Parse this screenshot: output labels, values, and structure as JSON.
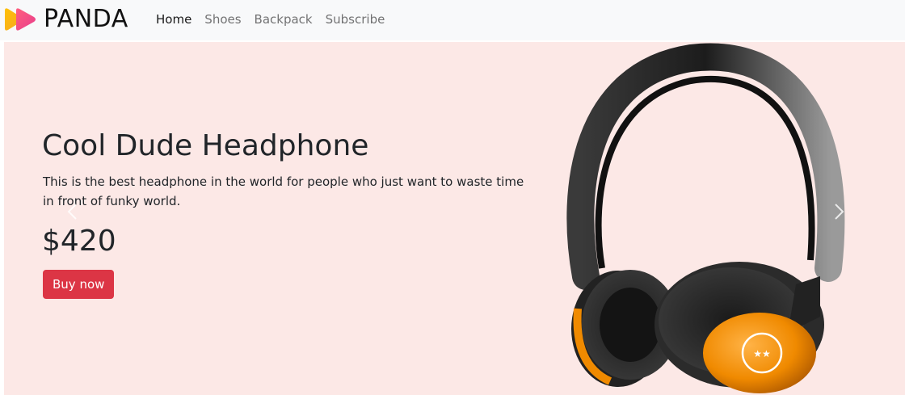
{
  "brand": {
    "name": "PANDA",
    "logo_icon": "play-logo-icon"
  },
  "nav": {
    "items": [
      {
        "label": "Home",
        "active": true
      },
      {
        "label": "Shoes",
        "active": false
      },
      {
        "label": "Backpack",
        "active": false
      },
      {
        "label": "Subscribe",
        "active": false
      }
    ]
  },
  "hero": {
    "title": "Cool Dude Headphone",
    "description": "This is the best headphone in the world for people who just want to waste time in front of funky world.",
    "price": "$420",
    "cta_label": "Buy now",
    "image_icon": "headphone-image",
    "prev_icon": "chevron-left-icon",
    "next_icon": "chevron-right-icon"
  },
  "colors": {
    "hero_bg": "#fce8e6",
    "button": "#dc3545",
    "navbar_bg": "#f8f9fa",
    "logo_gradient": [
      "#ffc107",
      "#e83e8c"
    ]
  }
}
